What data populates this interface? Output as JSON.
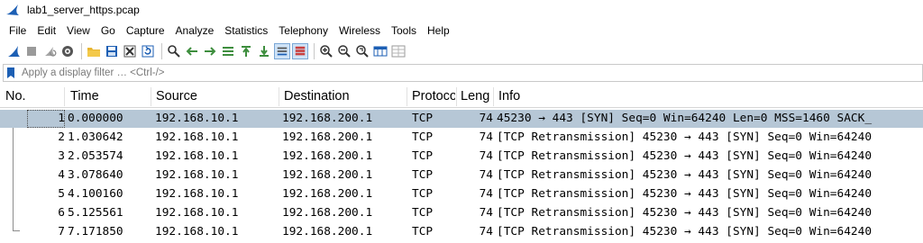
{
  "window": {
    "title": "lab1_server_https.pcap"
  },
  "menu": [
    "File",
    "Edit",
    "View",
    "Go",
    "Capture",
    "Analyze",
    "Statistics",
    "Telephony",
    "Wireless",
    "Tools",
    "Help"
  ],
  "toolbar": {
    "icons": [
      "shark-fin-start-icon",
      "stop-capture-icon",
      "restart-capture-icon",
      "capture-options-icon",
      "open-file-icon",
      "save-file-icon",
      "close-file-icon",
      "reload-file-icon",
      "find-packet-icon",
      "go-back-icon",
      "go-forward-icon",
      "go-to-packet-icon",
      "go-first-packet-icon",
      "go-last-packet-icon",
      "autoscroll-icon",
      "colorize-icon",
      "zoom-in-icon",
      "zoom-out-icon",
      "normal-size-icon",
      "resize-columns-icon",
      "expand-subtrees-icon"
    ]
  },
  "filter": {
    "placeholder": "Apply a display filter … <Ctrl-/>"
  },
  "columns": {
    "no": "No.",
    "time": "Time",
    "source": "Source",
    "destination": "Destination",
    "protocol": "Protocol",
    "length": "Length",
    "info": "Info"
  },
  "columns_visible": {
    "protocol": "Protoco",
    "length": "Leng"
  },
  "packets": [
    {
      "no": "1",
      "time": "0.000000",
      "source": "192.168.10.1",
      "destination": "192.168.200.1",
      "protocol": "TCP",
      "length": "74",
      "info": "45230 → 443 [SYN] Seq=0 Win=64240 Len=0 MSS=1460 SACK_"
    },
    {
      "no": "2",
      "time": "1.030642",
      "source": "192.168.10.1",
      "destination": "192.168.200.1",
      "protocol": "TCP",
      "length": "74",
      "info": "[TCP Retransmission] 45230 → 443 [SYN] Seq=0 Win=64240"
    },
    {
      "no": "3",
      "time": "2.053574",
      "source": "192.168.10.1",
      "destination": "192.168.200.1",
      "protocol": "TCP",
      "length": "74",
      "info": "[TCP Retransmission] 45230 → 443 [SYN] Seq=0 Win=64240"
    },
    {
      "no": "4",
      "time": "3.078640",
      "source": "192.168.10.1",
      "destination": "192.168.200.1",
      "protocol": "TCP",
      "length": "74",
      "info": "[TCP Retransmission] 45230 → 443 [SYN] Seq=0 Win=64240"
    },
    {
      "no": "5",
      "time": "4.100160",
      "source": "192.168.10.1",
      "destination": "192.168.200.1",
      "protocol": "TCP",
      "length": "74",
      "info": "[TCP Retransmission] 45230 → 443 [SYN] Seq=0 Win=64240"
    },
    {
      "no": "6",
      "time": "5.125561",
      "source": "192.168.10.1",
      "destination": "192.168.200.1",
      "protocol": "TCP",
      "length": "74",
      "info": "[TCP Retransmission] 45230 → 443 [SYN] Seq=0 Win=64240"
    },
    {
      "no": "7",
      "time": "7.171850",
      "source": "192.168.10.1",
      "destination": "192.168.200.1",
      "protocol": "TCP",
      "length": "74",
      "info": "[TCP Retransmission] 45230 → 443 [SYN] Seq=0 Win=64240"
    }
  ],
  "selected_row": "1",
  "colors": {
    "selected_row_bg": "#b6c7d6",
    "accent_blue": "#1c5fb4"
  }
}
